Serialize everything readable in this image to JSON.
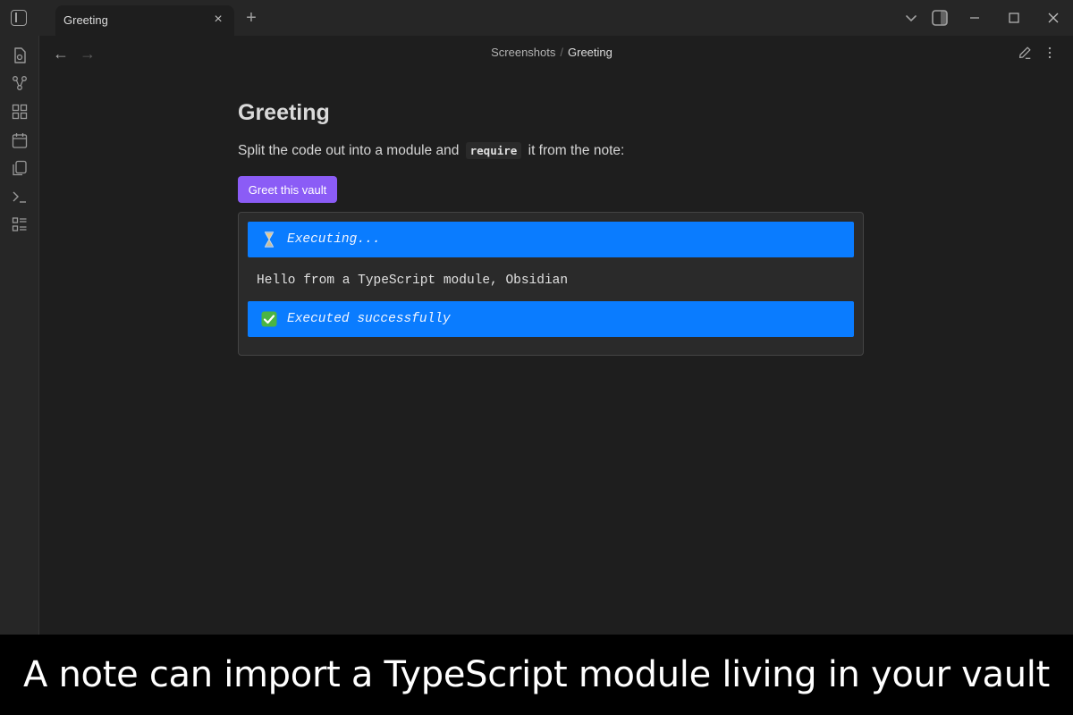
{
  "titlebar": {
    "tab_title": "Greeting",
    "tab_close_glyph": "×",
    "new_tab_glyph": "+",
    "icons": [
      "sidebar-toggle-icon",
      "chevron-down-icon",
      "right-sidebar-icon",
      "minimize-icon",
      "maximize-icon",
      "close-window-icon"
    ]
  },
  "ribbon": {
    "icons": [
      "open-file-icon",
      "graph-view-icon",
      "canvas-icon",
      "daily-note-icon",
      "templates-icon",
      "command-palette-icon",
      "bases-icon"
    ]
  },
  "nav": {
    "back_glyph": "←",
    "forward_glyph": "→"
  },
  "breadcrumb": {
    "parent": "Screenshots",
    "separator": "/",
    "current": "Greeting"
  },
  "note": {
    "title": "Greeting",
    "para_before": "Split the code out into a module and",
    "code": "require",
    "para_after": "it from the note:",
    "button_label": "Greet this vault"
  },
  "output": {
    "executing": "Executing...",
    "result": "Hello from a TypeScript module, Obsidian",
    "success": "Executed successfully"
  },
  "caption": {
    "text": "A note can import a TypeScript module living in your vault"
  },
  "colors": {
    "accent_button": "#8b5cf6",
    "status_bar": "#0a7cff",
    "background": "#1e1e1e",
    "chrome": "#262626"
  }
}
